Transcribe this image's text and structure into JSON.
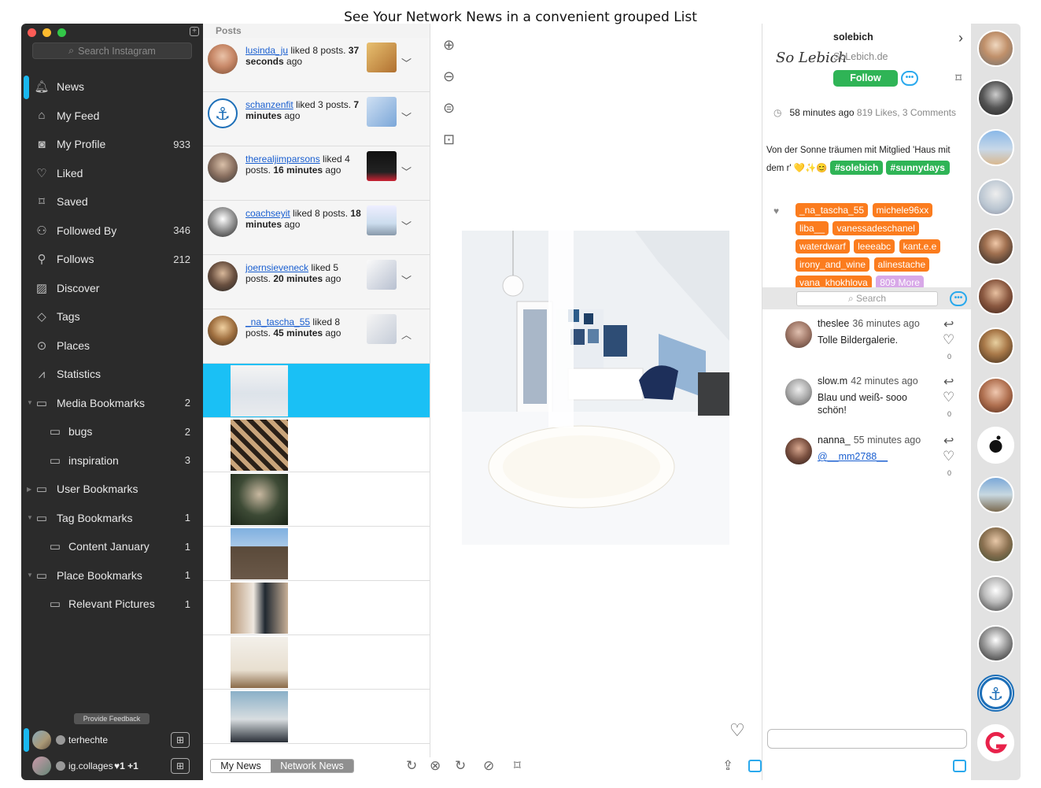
{
  "caption": "See Your Network News in a convenient grouped List",
  "sidebar": {
    "search_placeholder": "Search Instagram",
    "items": [
      {
        "label": "News",
        "icon": "bell-icon",
        "count": ""
      },
      {
        "label": "My Feed",
        "icon": "home-icon",
        "count": ""
      },
      {
        "label": "My Profile",
        "icon": "camera-icon",
        "count": "933"
      },
      {
        "label": "Liked",
        "icon": "heart-icon",
        "count": ""
      },
      {
        "label": "Saved",
        "icon": "bookmark-icon",
        "count": ""
      },
      {
        "label": "Followed By",
        "icon": "users-icon",
        "count": "346"
      },
      {
        "label": "Follows",
        "icon": "user-icon",
        "count": "212"
      },
      {
        "label": "Discover",
        "icon": "image-icon",
        "count": ""
      },
      {
        "label": "Tags",
        "icon": "tag-icon",
        "count": ""
      },
      {
        "label": "Places",
        "icon": "pin-icon",
        "count": ""
      },
      {
        "label": "Statistics",
        "icon": "chart-icon",
        "count": ""
      },
      {
        "label": "Media Bookmarks",
        "icon": "folder-icon",
        "count": "2"
      },
      {
        "label": "bugs",
        "icon": "folder-icon",
        "count": "2"
      },
      {
        "label": "inspiration",
        "icon": "folder-icon",
        "count": "3"
      },
      {
        "label": "User Bookmarks",
        "icon": "folder-icon",
        "count": ""
      },
      {
        "label": "Tag Bookmarks",
        "icon": "folder-icon",
        "count": "1"
      },
      {
        "label": "Content January",
        "icon": "folder-icon",
        "count": "1"
      },
      {
        "label": "Place Bookmarks",
        "icon": "folder-icon",
        "count": "1"
      },
      {
        "label": "Relevant Pictures",
        "icon": "folder-icon",
        "count": "1"
      }
    ],
    "feedback": "Provide Feedback",
    "accounts": [
      {
        "name": "terhechte",
        "stat": ""
      },
      {
        "name": "ig.collages",
        "stat": "♥1  +1"
      }
    ]
  },
  "posts": {
    "header": "Posts",
    "news": [
      {
        "user": "lusinda_ju",
        "pre": " liked 8 posts. ",
        "bold": "37 seconds",
        "post": " ago"
      },
      {
        "user": "schanzenfit",
        "pre": " liked 3 posts. ",
        "bold": "7 minutes",
        "post": " ago"
      },
      {
        "user": "therealjimparsons",
        "pre": " liked 4 posts. ",
        "bold": "16 minutes",
        "post": " ago"
      },
      {
        "user": "coachseyit",
        "pre": " liked 8 posts. ",
        "bold": "18 minutes",
        "post": " ago"
      },
      {
        "user": "joernsieveneck",
        "pre": " liked 5 posts. ",
        "bold": "20 minutes",
        "post": " ago"
      },
      {
        "user": "_na_tascha_55",
        "pre": " liked 8 posts. ",
        "bold": "45 minutes",
        "post": " ago"
      }
    ]
  },
  "toolbar": {
    "tab_my_news": "My News",
    "tab_network_news": "Network News"
  },
  "detail": {
    "logo": "So Lebich",
    "username": "solebich",
    "website": "SoLebich.de",
    "follow": "Follow",
    "time": "58 minutes ago",
    "meta": "819 Likes, 3 Comments",
    "caption": "Von der Sonne träumen mit Mitglied 'Haus mit dem r'",
    "emojis": "💛✨😊",
    "hashtags": [
      "#solebich",
      "#sunnydays"
    ],
    "likers": [
      "_na_tascha_55",
      "michele96xx",
      "liba__",
      "vanessadeschanel",
      "waterdwarf",
      "leeeabc",
      "kant.e.e",
      "irony_and_wine",
      "alinestache",
      "vana_khokhlova"
    ],
    "likers_more": "809 More",
    "comment_search": "Search",
    "comments": [
      {
        "user": "theslee",
        "when": "36 minutes ago",
        "text": "Tolle Bildergalerie.",
        "likes": "0",
        "mention": false
      },
      {
        "user": "slow.m",
        "when": "42 minutes ago",
        "text": "Blau und weiß- sooo schön!",
        "likes": "0",
        "mention": false
      },
      {
        "user": "nanna_",
        "when": "55 minutes ago",
        "text": "@__mm2788__",
        "likes": "0",
        "mention": true
      }
    ]
  },
  "colors": {
    "accent": "#1ab8f0",
    "follow": "#2fb456",
    "liker_chip": "#fb7c1e",
    "more_chip": "#d8a8e8",
    "sidebar": "#2b2b2b"
  }
}
